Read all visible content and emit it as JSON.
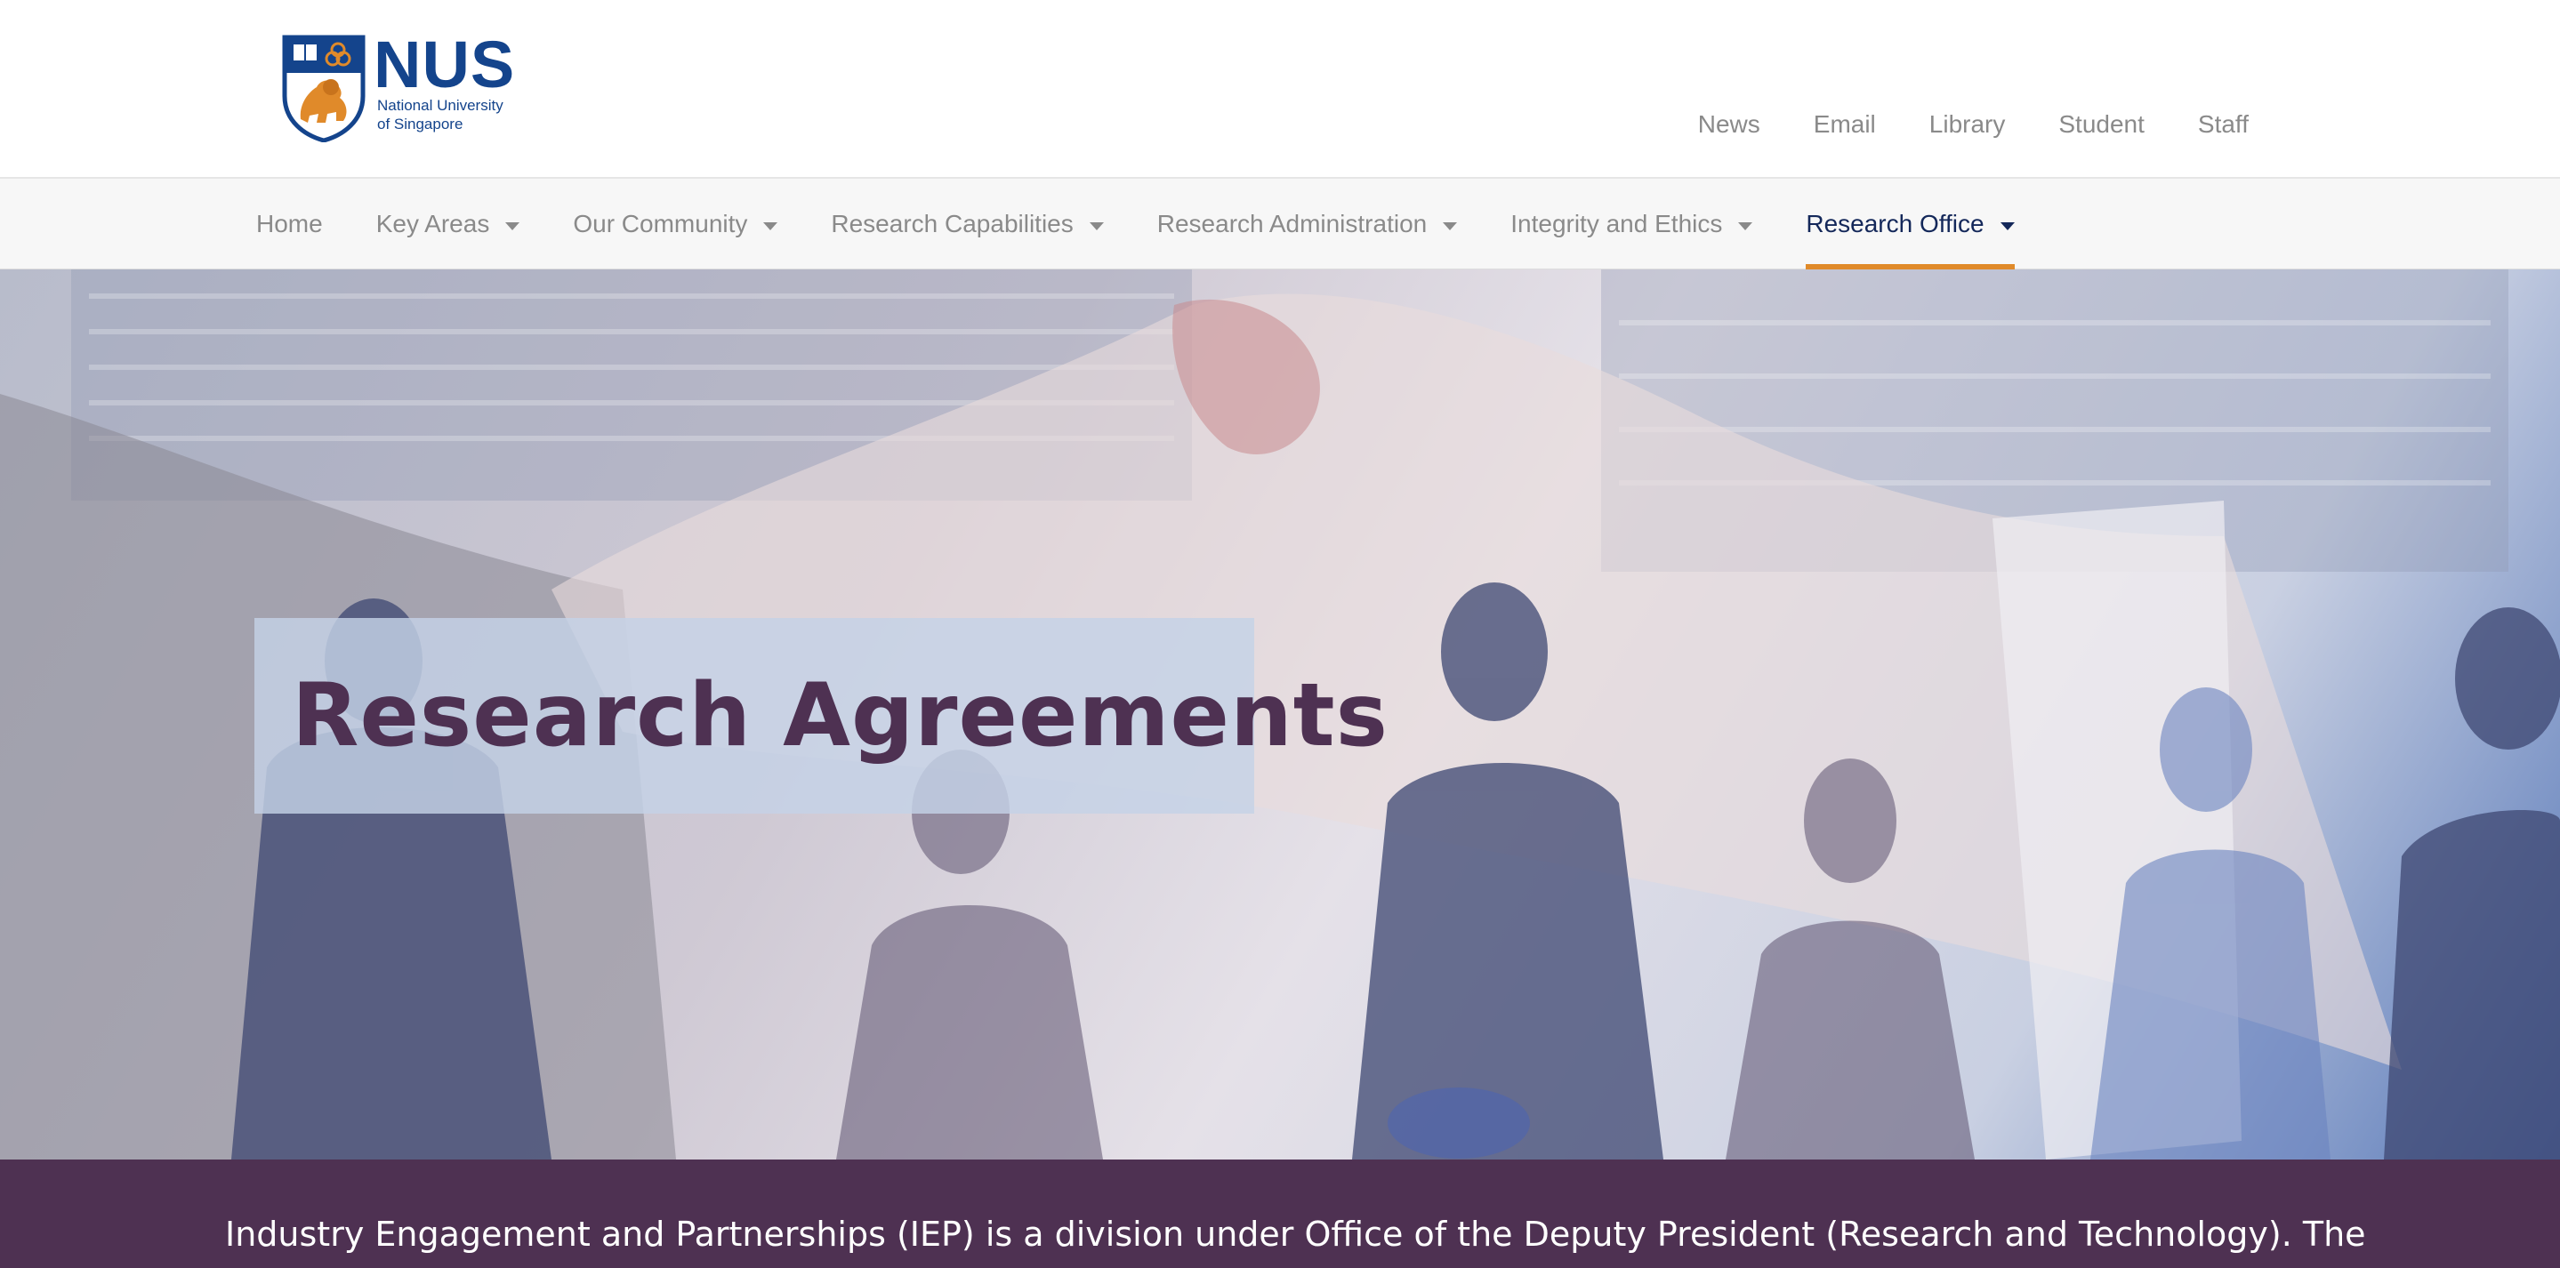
{
  "logo": {
    "wordmark": "NUS",
    "line1": "National University",
    "line2": "of Singapore"
  },
  "utility_nav": {
    "items": [
      "News",
      "Email",
      "Library",
      "Student",
      "Staff"
    ]
  },
  "main_nav": {
    "items": [
      {
        "label": "Home"
      },
      {
        "label": "Key Areas"
      },
      {
        "label": "Our Community"
      },
      {
        "label": "Research Capabilities"
      },
      {
        "label": "Research Administration"
      },
      {
        "label": "Integrity and Ethics"
      },
      {
        "label": "Research Office"
      }
    ],
    "active": "Research Office"
  },
  "hero": {
    "title": "Research Agreements"
  },
  "intro": {
    "text": "Industry Engagement and Partnerships (IEP) is a division under Office of the Deputy President (Research and Technology). The"
  },
  "colors": {
    "brand_blue": "#14448c",
    "brand_orange": "#e08a2a",
    "purple": "#4e3152",
    "nav_grey": "#8a8a8a"
  }
}
